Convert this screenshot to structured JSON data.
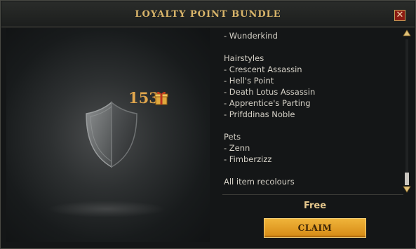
{
  "window": {
    "title": "LOYALTY POINT BUNDLE",
    "close_label": "✕"
  },
  "bundle": {
    "points": "153"
  },
  "contents": {
    "lines": [
      "- Wunderkind",
      "",
      "Hairstyles",
      "- Crescent Assassin",
      "- Hell's Point",
      "- Death Lotus Assassin",
      "- Apprentice's Parting",
      "- Prifddinas Noble",
      "",
      "Pets",
      "- Zenn",
      "- Fimberzizz",
      "",
      "All item recolours"
    ]
  },
  "footer": {
    "price": "Free",
    "claim_label": "CLAIM"
  },
  "colors": {
    "accent": "#d9b56a",
    "button": "#e6a12a",
    "close": "#8b1b12"
  }
}
